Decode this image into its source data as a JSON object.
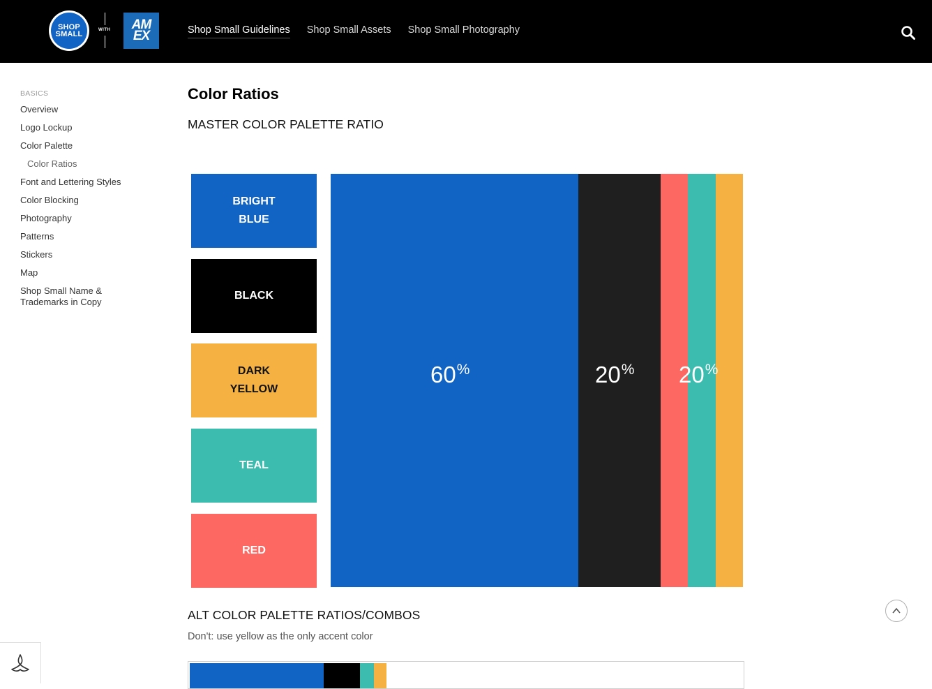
{
  "header": {
    "logo": {
      "shop_line1": "SHOP",
      "shop_line2": "SMALL",
      "with": "WITH",
      "amex_line1": "AM",
      "amex_line2": "EX"
    },
    "nav": [
      {
        "label": "Shop Small Guidelines",
        "active": true
      },
      {
        "label": "Shop Small Assets",
        "active": false
      },
      {
        "label": "Shop Small Photography",
        "active": false
      }
    ],
    "search_icon": "search-icon"
  },
  "sidebar": {
    "heading": "BASICS",
    "items": [
      {
        "label": "Overview"
      },
      {
        "label": "Logo Lockup"
      },
      {
        "label": "Color Palette"
      },
      {
        "label": "Color Ratios",
        "sub": true,
        "active": true
      },
      {
        "label": "Font and Lettering Styles"
      },
      {
        "label": "Color Blocking"
      },
      {
        "label": "Photography"
      },
      {
        "label": "Patterns"
      },
      {
        "label": "Stickers"
      },
      {
        "label": "Map"
      },
      {
        "label": "Shop Small Name & Trademarks in Copy"
      }
    ]
  },
  "main": {
    "title": "Color Ratios",
    "master_heading": "MASTER COLOR PALETTE RATIO",
    "swatches": [
      {
        "label": "BRIGHT\nBLUE",
        "color": "#1264c4",
        "text_color": "#ffffff"
      },
      {
        "label": "BLACK",
        "color": "#000000",
        "text_color": "#ffffff"
      },
      {
        "label": "DARK\nYELLOW",
        "color": "#f5b242",
        "text_color": "#111111"
      },
      {
        "label": "TEAL",
        "color": "#3bbcae",
        "text_color": "#ffffff"
      },
      {
        "label": "RED",
        "color": "#fd6863",
        "text_color": "#ffffff"
      }
    ],
    "ratio_bar": {
      "segments": [
        {
          "name": "bright-blue",
          "color": "#1264c4",
          "share": 60
        },
        {
          "name": "black",
          "color": "#1f1f1f",
          "share": 20
        },
        {
          "name": "red",
          "color": "#fd6863",
          "share": 6.67
        },
        {
          "name": "teal",
          "color": "#3bbcae",
          "share": 6.67
        },
        {
          "name": "dark-yellow",
          "color": "#f5b242",
          "share": 6.67
        }
      ],
      "labels": [
        {
          "value": "60",
          "unit": "%"
        },
        {
          "value": "20",
          "unit": "%"
        },
        {
          "value": "20",
          "unit": "%"
        }
      ]
    },
    "alt_heading": "ALT COLOR PALETTE RATIOS/COMBOS",
    "alt_note": "Don't: use yellow as the only accent color",
    "alt_bar": [
      {
        "name": "bright-blue",
        "color": "#1264c4",
        "share": 24.2
      },
      {
        "name": "black",
        "color": "#000000",
        "share": 6.5
      },
      {
        "name": "teal",
        "color": "#3bbcae",
        "share": 2.5
      },
      {
        "name": "dark-yellow",
        "color": "#f5b242",
        "share": 2.3
      }
    ]
  }
}
